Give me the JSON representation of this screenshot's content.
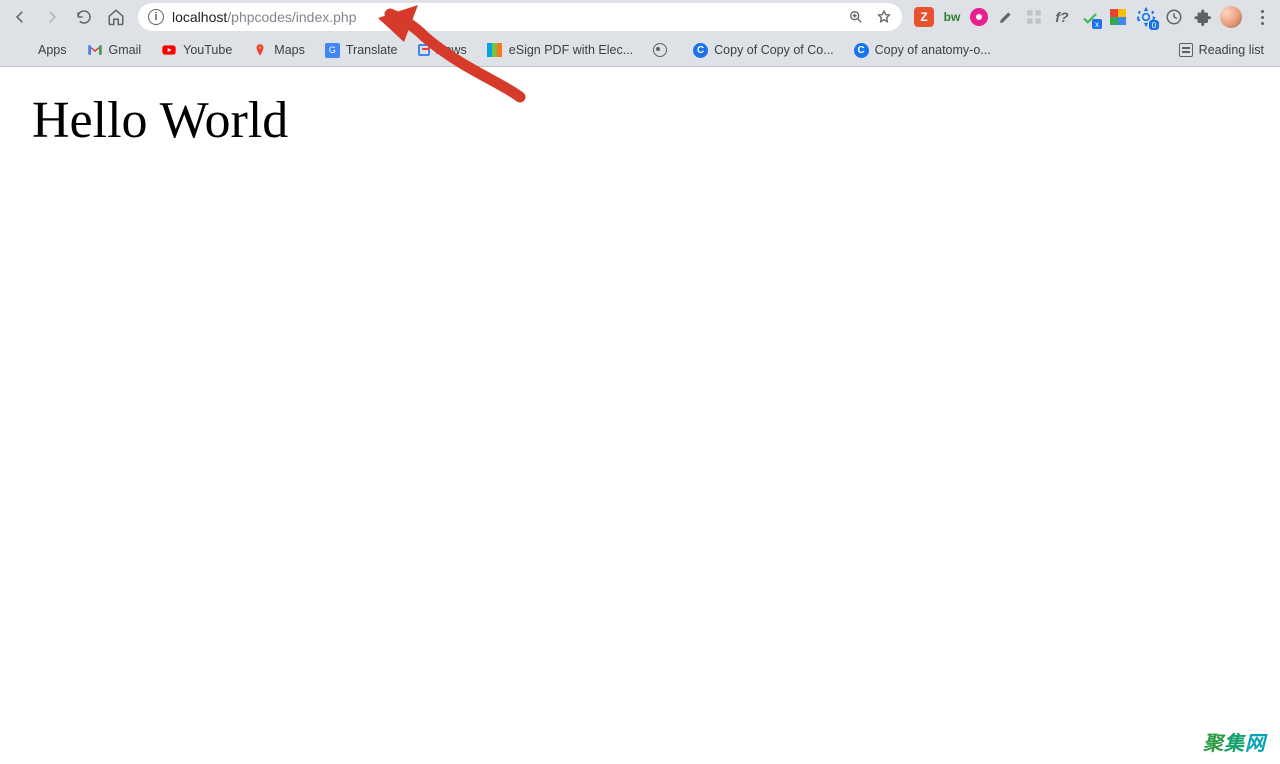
{
  "toolbar": {
    "url_host": "localhost",
    "url_path": "/phpcodes/index.php"
  },
  "extensions": {
    "gear_badge": "0"
  },
  "bookmarks": {
    "items": [
      {
        "label": "Apps"
      },
      {
        "label": "Gmail"
      },
      {
        "label": "YouTube"
      },
      {
        "label": "Maps"
      },
      {
        "label": "Translate"
      },
      {
        "label": "News"
      },
      {
        "label": "eSign PDF with Elec..."
      },
      {
        "label": ""
      },
      {
        "label": "Copy of Copy of Co..."
      },
      {
        "label": "Copy of anatomy-o..."
      }
    ],
    "reading_list_label": "Reading list"
  },
  "page": {
    "heading": "Hello World"
  },
  "watermark": {
    "t1": "聚",
    "t2": "集",
    "t3": "网"
  }
}
